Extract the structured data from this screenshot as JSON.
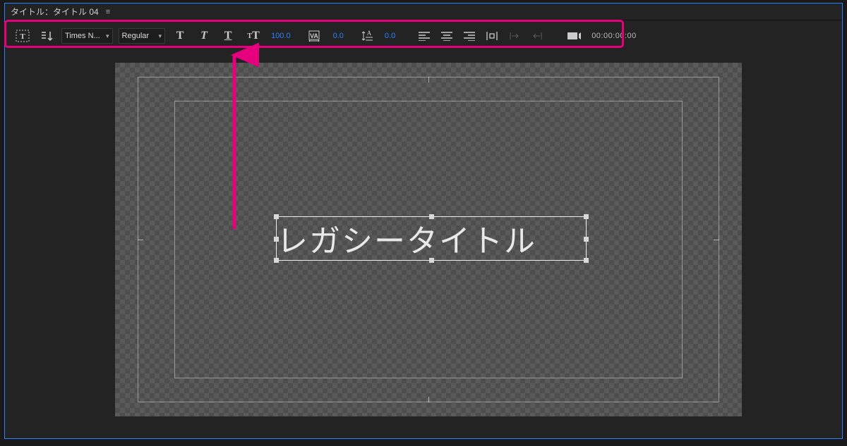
{
  "tab": {
    "title": "タイトル：タイトル 04"
  },
  "toolbar": {
    "font_family": "Times N...",
    "font_style": "Regular",
    "font_size": "100.0",
    "kerning": "0.0",
    "leading": "0.0",
    "timecode": "00:00:00:00"
  },
  "canvas": {
    "title_text": "レガシータイトル"
  },
  "annotation": {
    "color": "#e6007e"
  }
}
